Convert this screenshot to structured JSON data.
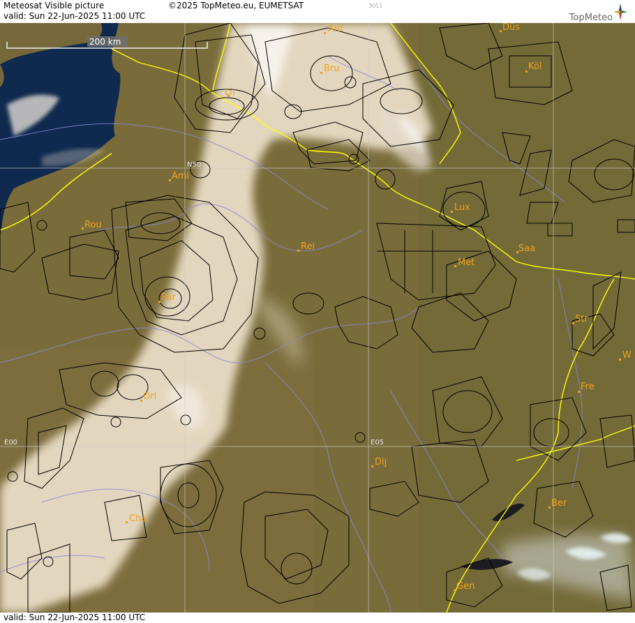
{
  "header": {
    "title": "Meteosat Visible picture",
    "valid": "valid:  Sun  22-Jun-2025  11:00 UTC",
    "copyright": "©2025 TopMeteo.eu, EUMETSAT",
    "code": "3011",
    "logo_text": "TopMeteo"
  },
  "footer": {
    "valid": "valid:  Sun  22-Jun-2025  11:00 UTC"
  },
  "scale": {
    "label": "200 km"
  },
  "grid_labels": {
    "n50": "N50",
    "e00": "E00",
    "e05": "E05"
  },
  "cities": [
    "Ant",
    "Düs",
    "Bru",
    "Köl",
    "Lil",
    "Ami",
    "Rou",
    "Lux",
    "Rei",
    "Saa",
    "Met",
    "Par",
    "Str",
    "W",
    "Fre",
    "Orl",
    "Dij",
    "Ber",
    "Cha",
    "Gen"
  ],
  "colors": {
    "land": "#7a6c3a",
    "sea": "#0f2a4e",
    "cloud": "#ecdfc9",
    "border": "#ffff00",
    "rivers": "#8a87d8",
    "city": "#f0a21f"
  }
}
